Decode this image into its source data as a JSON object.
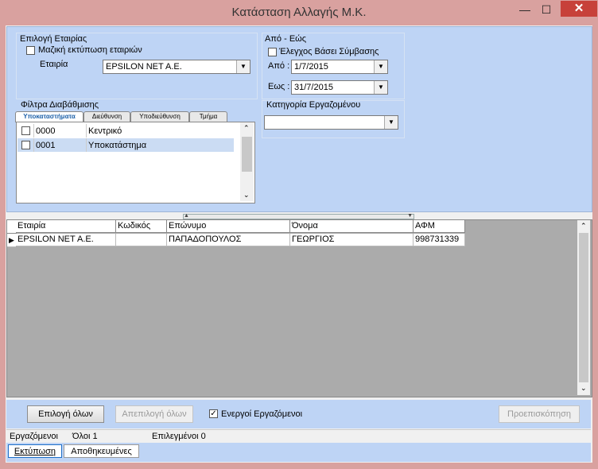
{
  "window": {
    "title": "Κατάσταση Αλλαγής Μ.Κ.",
    "minimize": "—",
    "maximize": "☐",
    "close": "✕"
  },
  "company": {
    "group_label": "Επιλογή Εταιρίας",
    "bulk_print_label": "Μαζική εκτύπωση εταιριών",
    "bulk_print_checked": false,
    "company_label": "Εταιρία",
    "company_value": "EPSILON NET A.E."
  },
  "period": {
    "group_label": "Από - Εώς",
    "contract_check_label": "Έλεγχος Βάσει Σύμβασης",
    "contract_check_checked": false,
    "from_label": "Από :",
    "from_value": "1/7/2015",
    "to_label": "Εως :",
    "to_value": "31/7/2015"
  },
  "filters": {
    "group_label": "Φίλτρα Διαβάθμισης",
    "tabs": [
      "Υποκαταστήματα",
      "Διεύθυνση",
      "Υποδιεύθυνση",
      "Τμήμα"
    ],
    "active_tab": 0,
    "items": [
      {
        "code": "0000",
        "name": "Κεντρικό",
        "checked": false
      },
      {
        "code": "0001",
        "name": "Υποκατάστημα",
        "checked": false
      }
    ]
  },
  "employee_category": {
    "group_label": "Κατηγορία Εργαζομένου",
    "value": ""
  },
  "grid": {
    "columns": [
      "Εταιρία",
      "Κωδικός",
      "Επώνυμο",
      "Όνομα",
      "ΑΦΜ"
    ],
    "rows": [
      {
        "company": "EPSILON NET A.E.",
        "code": "",
        "surname": "ΠΑΠΑΔΟΠΟΥΛΟΣ",
        "name": "ΓΕΩΡΓΙΟΣ",
        "afm": "998731339"
      }
    ]
  },
  "actions": {
    "select_all": "Επιλογή όλων",
    "deselect_all": "Απεπιλογή όλων",
    "active_employees_label": "Ενεργοί Εργαζόμενοι",
    "active_employees_checked": true,
    "preview": "Προεπισκόπηση"
  },
  "status": {
    "employees_label": "Εργαζόμενοι",
    "total": "Όλοι 1",
    "selected": "Επιλεγμένοι 0"
  },
  "bottom_tabs": [
    "Εκτύπωση",
    "Αποθηκευμένες"
  ]
}
